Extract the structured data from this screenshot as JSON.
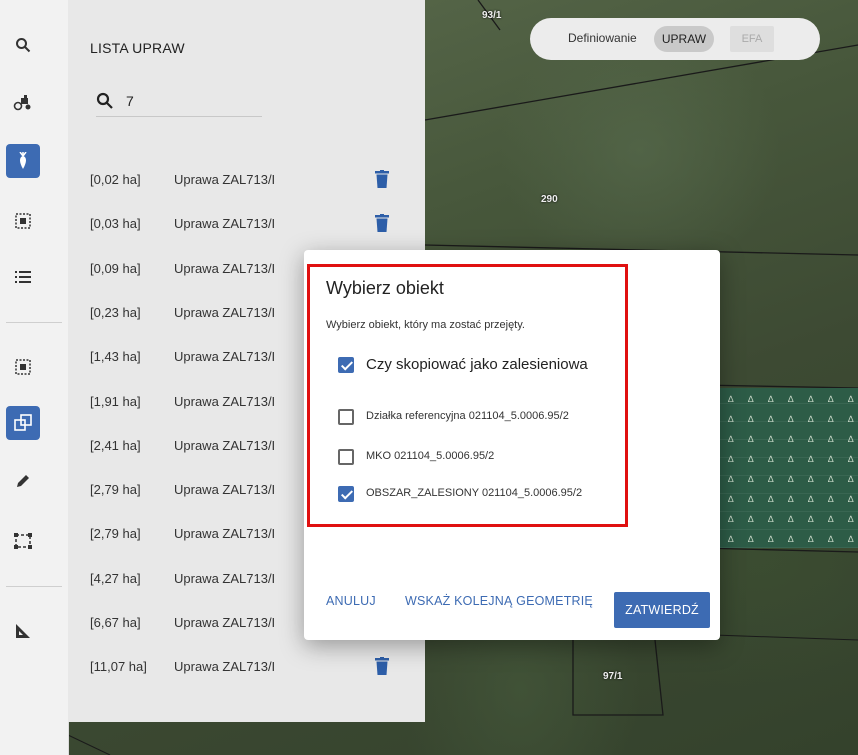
{
  "map": {
    "parcel_labels": [
      "93/1",
      "290",
      "97/1"
    ]
  },
  "toolbar": {
    "icons": [
      "search-icon",
      "tractor-icon",
      "crop-icon",
      "select-area-icon",
      "list-icon",
      "select-area-2-icon",
      "copy-geometry-icon",
      "pencil-icon",
      "rectangle-select-icon",
      "ruler-icon"
    ]
  },
  "panel": {
    "title": "LISTA UPRAW",
    "search_value": "7",
    "rows": [
      {
        "area": "[0,02 ha]",
        "name": "Uprawa ZAL713/I"
      },
      {
        "area": "[0,03 ha]",
        "name": "Uprawa ZAL713/I"
      },
      {
        "area": "[0,09 ha]",
        "name": "Uprawa ZAL713/I"
      },
      {
        "area": "[0,23 ha]",
        "name": "Uprawa ZAL713/I"
      },
      {
        "area": "[1,43 ha]",
        "name": "Uprawa ZAL713/I"
      },
      {
        "area": "[1,91 ha]",
        "name": "Uprawa ZAL713/I"
      },
      {
        "area": "[2,41 ha]",
        "name": "Uprawa ZAL713/I"
      },
      {
        "area": "[2,79 ha]",
        "name": "Uprawa ZAL713/I"
      },
      {
        "area": "[2,79 ha]",
        "name": "Uprawa ZAL713/I"
      },
      {
        "area": "[4,27 ha]",
        "name": "Uprawa ZAL713/I"
      },
      {
        "area": "[6,67 ha]",
        "name": "Uprawa ZAL713/I"
      },
      {
        "area": "[11,07 ha]",
        "name": "Uprawa ZAL713/I"
      }
    ]
  },
  "toggle": {
    "label": "Definiowanie",
    "option_on": "UPRAW",
    "option_off": "EFA"
  },
  "dialog": {
    "title": "Wybierz obiekt",
    "subtitle": "Wybierz obiekt, który ma zostać przejęty.",
    "copy_as_forest": {
      "label": "Czy skopiować jako zalesieniowa",
      "checked": true
    },
    "options": [
      {
        "label": "Działka referencyjna 021104_5.0006.95/2",
        "checked": false
      },
      {
        "label": "MKO 021104_5.0006.95/2",
        "checked": false
      },
      {
        "label": "OBSZAR_ZALESIONY 021104_5.0006.95/2",
        "checked": true
      }
    ],
    "cancel": "ANULUJ",
    "next_geometry": "WSKAŻ KOLEJNĄ GEOMETRIĘ",
    "confirm": "ZATWIERDŹ"
  },
  "colors": {
    "accent": "#3d6bb3",
    "highlight": "#e01010",
    "forest": "#2d5c47"
  }
}
